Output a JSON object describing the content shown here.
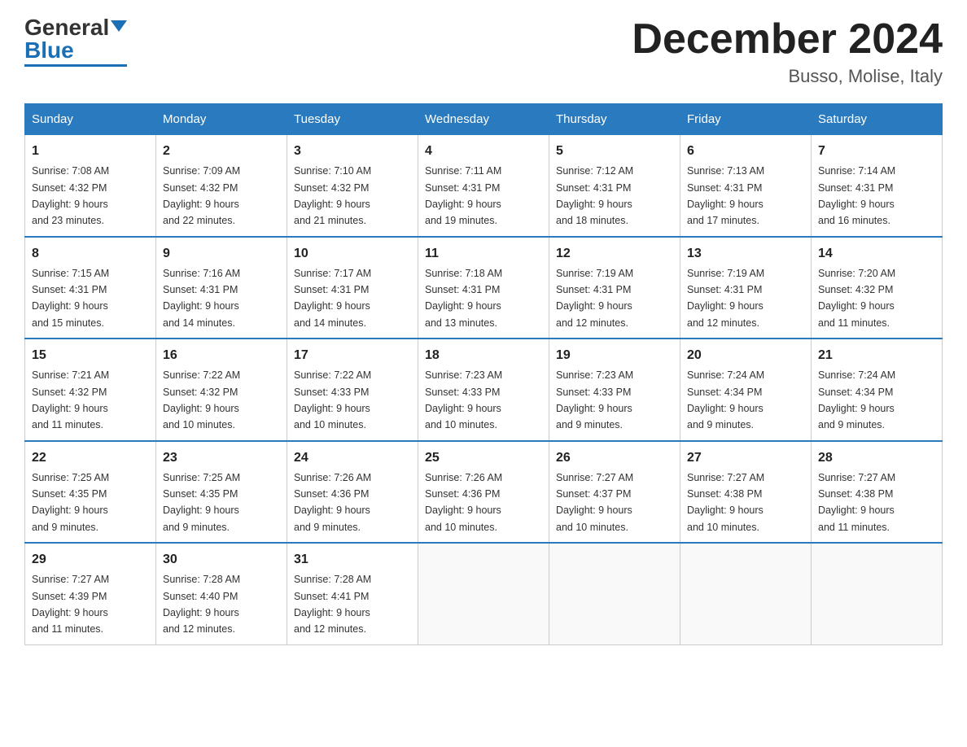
{
  "logo": {
    "general": "General",
    "blue": "Blue"
  },
  "title": "December 2024",
  "subtitle": "Busso, Molise, Italy",
  "days_of_week": [
    "Sunday",
    "Monday",
    "Tuesday",
    "Wednesday",
    "Thursday",
    "Friday",
    "Saturday"
  ],
  "weeks": [
    [
      {
        "day": "1",
        "sunrise": "7:08 AM",
        "sunset": "4:32 PM",
        "daylight": "9 hours and 23 minutes."
      },
      {
        "day": "2",
        "sunrise": "7:09 AM",
        "sunset": "4:32 PM",
        "daylight": "9 hours and 22 minutes."
      },
      {
        "day": "3",
        "sunrise": "7:10 AM",
        "sunset": "4:32 PM",
        "daylight": "9 hours and 21 minutes."
      },
      {
        "day": "4",
        "sunrise": "7:11 AM",
        "sunset": "4:31 PM",
        "daylight": "9 hours and 19 minutes."
      },
      {
        "day": "5",
        "sunrise": "7:12 AM",
        "sunset": "4:31 PM",
        "daylight": "9 hours and 18 minutes."
      },
      {
        "day": "6",
        "sunrise": "7:13 AM",
        "sunset": "4:31 PM",
        "daylight": "9 hours and 17 minutes."
      },
      {
        "day": "7",
        "sunrise": "7:14 AM",
        "sunset": "4:31 PM",
        "daylight": "9 hours and 16 minutes."
      }
    ],
    [
      {
        "day": "8",
        "sunrise": "7:15 AM",
        "sunset": "4:31 PM",
        "daylight": "9 hours and 15 minutes."
      },
      {
        "day": "9",
        "sunrise": "7:16 AM",
        "sunset": "4:31 PM",
        "daylight": "9 hours and 14 minutes."
      },
      {
        "day": "10",
        "sunrise": "7:17 AM",
        "sunset": "4:31 PM",
        "daylight": "9 hours and 14 minutes."
      },
      {
        "day": "11",
        "sunrise": "7:18 AM",
        "sunset": "4:31 PM",
        "daylight": "9 hours and 13 minutes."
      },
      {
        "day": "12",
        "sunrise": "7:19 AM",
        "sunset": "4:31 PM",
        "daylight": "9 hours and 12 minutes."
      },
      {
        "day": "13",
        "sunrise": "7:19 AM",
        "sunset": "4:31 PM",
        "daylight": "9 hours and 12 minutes."
      },
      {
        "day": "14",
        "sunrise": "7:20 AM",
        "sunset": "4:32 PM",
        "daylight": "9 hours and 11 minutes."
      }
    ],
    [
      {
        "day": "15",
        "sunrise": "7:21 AM",
        "sunset": "4:32 PM",
        "daylight": "9 hours and 11 minutes."
      },
      {
        "day": "16",
        "sunrise": "7:22 AM",
        "sunset": "4:32 PM",
        "daylight": "9 hours and 10 minutes."
      },
      {
        "day": "17",
        "sunrise": "7:22 AM",
        "sunset": "4:33 PM",
        "daylight": "9 hours and 10 minutes."
      },
      {
        "day": "18",
        "sunrise": "7:23 AM",
        "sunset": "4:33 PM",
        "daylight": "9 hours and 10 minutes."
      },
      {
        "day": "19",
        "sunrise": "7:23 AM",
        "sunset": "4:33 PM",
        "daylight": "9 hours and 9 minutes."
      },
      {
        "day": "20",
        "sunrise": "7:24 AM",
        "sunset": "4:34 PM",
        "daylight": "9 hours and 9 minutes."
      },
      {
        "day": "21",
        "sunrise": "7:24 AM",
        "sunset": "4:34 PM",
        "daylight": "9 hours and 9 minutes."
      }
    ],
    [
      {
        "day": "22",
        "sunrise": "7:25 AM",
        "sunset": "4:35 PM",
        "daylight": "9 hours and 9 minutes."
      },
      {
        "day": "23",
        "sunrise": "7:25 AM",
        "sunset": "4:35 PM",
        "daylight": "9 hours and 9 minutes."
      },
      {
        "day": "24",
        "sunrise": "7:26 AM",
        "sunset": "4:36 PM",
        "daylight": "9 hours and 9 minutes."
      },
      {
        "day": "25",
        "sunrise": "7:26 AM",
        "sunset": "4:36 PM",
        "daylight": "9 hours and 10 minutes."
      },
      {
        "day": "26",
        "sunrise": "7:27 AM",
        "sunset": "4:37 PM",
        "daylight": "9 hours and 10 minutes."
      },
      {
        "day": "27",
        "sunrise": "7:27 AM",
        "sunset": "4:38 PM",
        "daylight": "9 hours and 10 minutes."
      },
      {
        "day": "28",
        "sunrise": "7:27 AM",
        "sunset": "4:38 PM",
        "daylight": "9 hours and 11 minutes."
      }
    ],
    [
      {
        "day": "29",
        "sunrise": "7:27 AM",
        "sunset": "4:39 PM",
        "daylight": "9 hours and 11 minutes."
      },
      {
        "day": "30",
        "sunrise": "7:28 AM",
        "sunset": "4:40 PM",
        "daylight": "9 hours and 12 minutes."
      },
      {
        "day": "31",
        "sunrise": "7:28 AM",
        "sunset": "4:41 PM",
        "daylight": "9 hours and 12 minutes."
      },
      null,
      null,
      null,
      null
    ]
  ],
  "labels": {
    "sunrise": "Sunrise:",
    "sunset": "Sunset:",
    "daylight": "Daylight:"
  }
}
